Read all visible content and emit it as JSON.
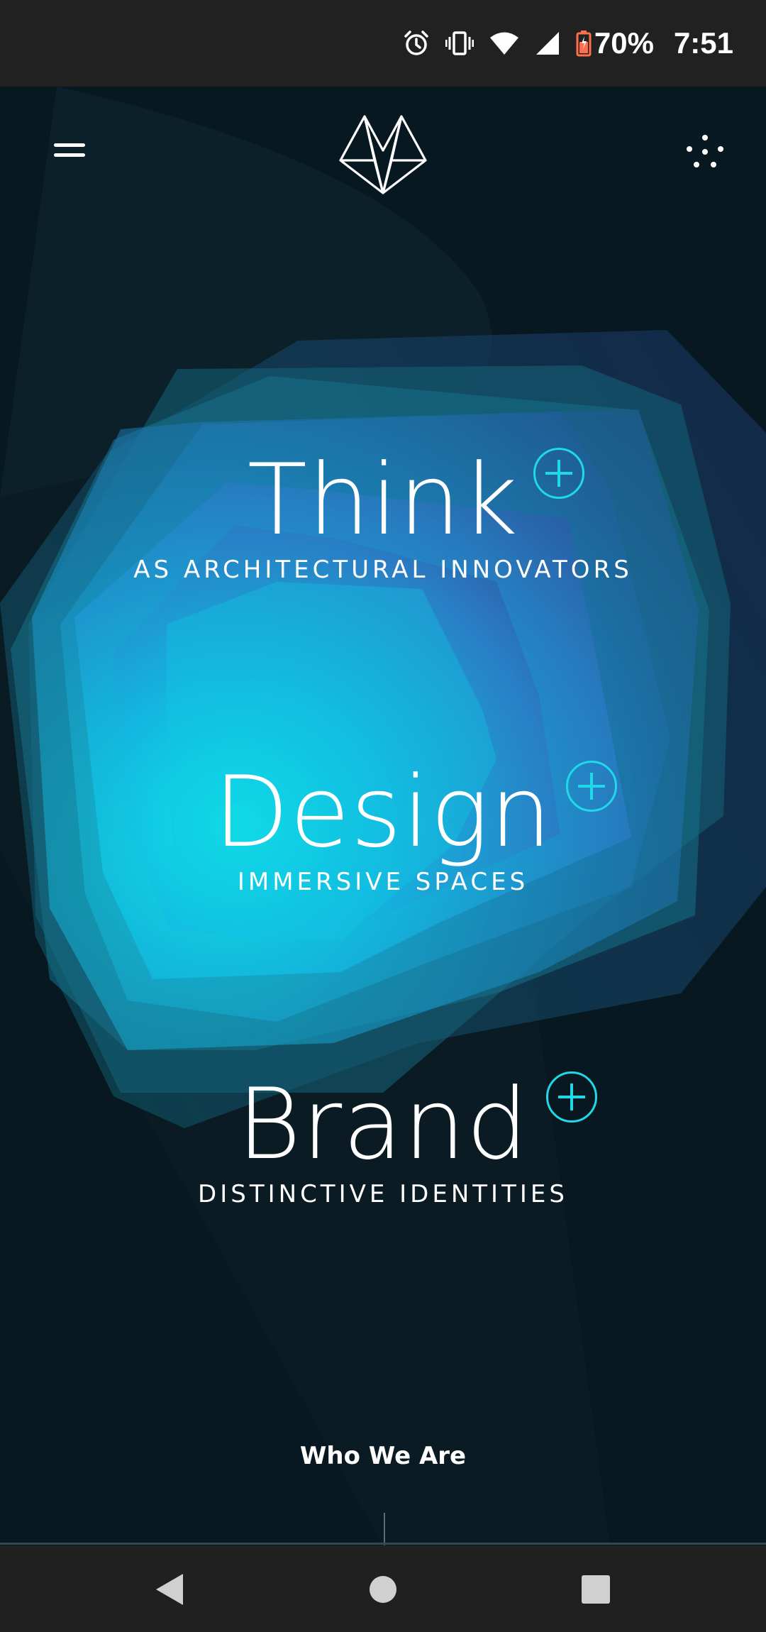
{
  "status_bar": {
    "battery_percent": "70%",
    "time": "7:51",
    "icons": [
      "alarm-icon",
      "vibrate-icon",
      "wifi-icon",
      "signal-icon",
      "battery-icon"
    ],
    "battery_color": "#ff6f4d"
  },
  "header": {
    "menu_icon": "hamburger-menu-icon",
    "logo_icon": "geometric-logo-icon",
    "more_icon": "dots-menu-icon"
  },
  "features": [
    {
      "title": "Think",
      "subtitle": "AS ARCHITECTURAL INNOVATORS"
    },
    {
      "title": "Design",
      "subtitle": "IMMERSIVE SPACES"
    },
    {
      "title": "Brand",
      "subtitle": "DISTINCTIVE IDENTITIES"
    }
  ],
  "who_we_are": "Who We Are",
  "colors": {
    "accent": "#1fd9e8",
    "background": "#081720",
    "glow_core": "#0fe0e8",
    "glow_edge": "#1e4d8c"
  },
  "nav_bar": {
    "icons": [
      "back-icon",
      "home-icon",
      "recents-icon"
    ]
  }
}
